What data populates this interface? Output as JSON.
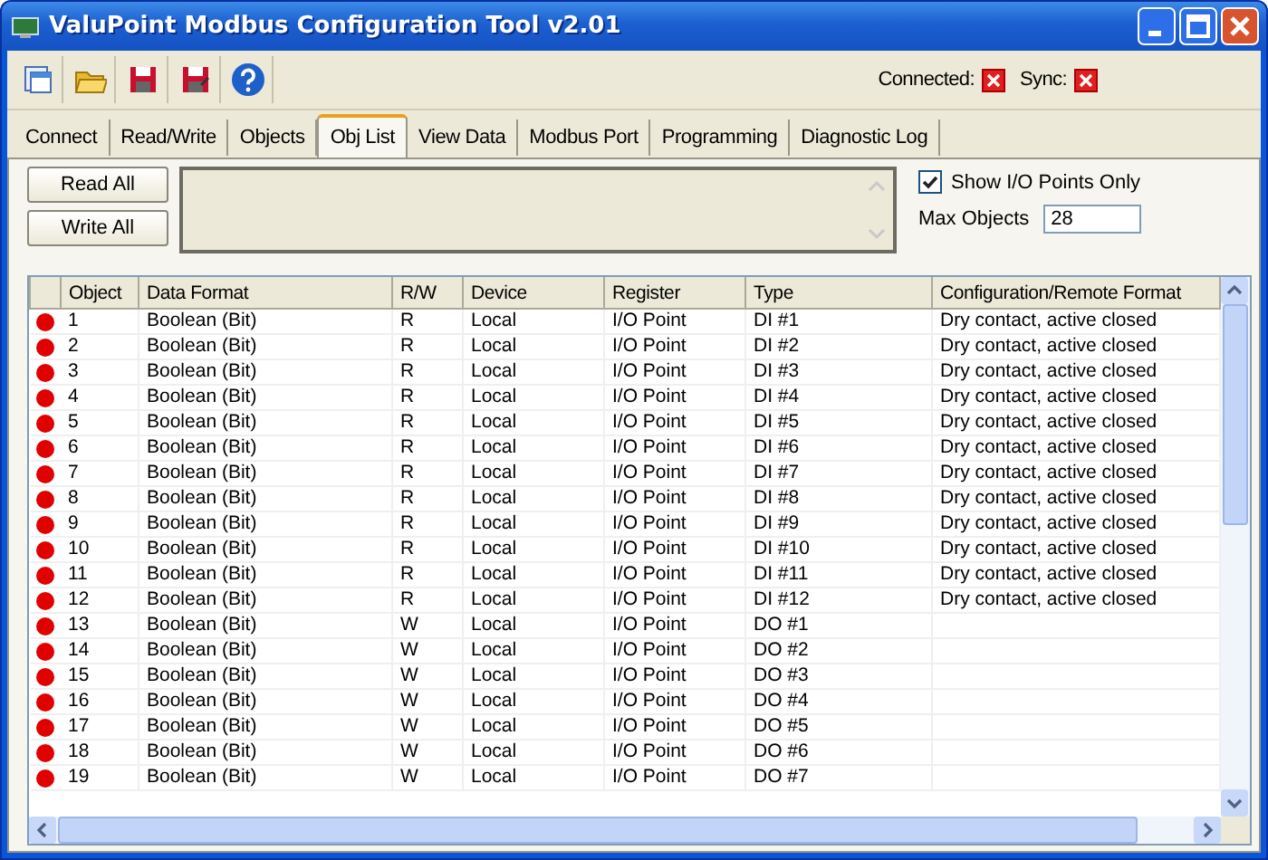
{
  "window": {
    "title": "ValuPoint Modbus Configuration Tool v2.01"
  },
  "status": [
    {
      "label": "Connected:",
      "connected": false
    },
    {
      "label": "Sync:",
      "connected": false
    }
  ],
  "tabs": [
    {
      "label": "Connect",
      "selected": false
    },
    {
      "label": "Read/Write",
      "selected": false
    },
    {
      "label": "Objects",
      "selected": false
    },
    {
      "label": "Obj List",
      "selected": true
    },
    {
      "label": "View Data",
      "selected": false
    },
    {
      "label": "Modbus Port",
      "selected": false
    },
    {
      "label": "Programming",
      "selected": false
    },
    {
      "label": "Diagnostic Log",
      "selected": false
    }
  ],
  "buttons": [
    "Read All",
    "Write All"
  ],
  "show_io_only": {
    "label": "Show I/O Points Only",
    "checked": true
  },
  "max_objects": {
    "label": "Max Objects",
    "value": "28"
  },
  "table": {
    "columns": [
      "Object",
      "Data Format",
      "R/W",
      "Device",
      "Register",
      "Type",
      "Configuration/Remote Format"
    ],
    "rows": [
      {
        "object": "1",
        "data_format": "Boolean (Bit)",
        "rw": "R",
        "device": "Local",
        "register": "I/O Point",
        "type": "DI #1",
        "config": "Dry contact, active closed"
      },
      {
        "object": "2",
        "data_format": "Boolean (Bit)",
        "rw": "R",
        "device": "Local",
        "register": "I/O Point",
        "type": "DI #2",
        "config": "Dry contact, active closed"
      },
      {
        "object": "3",
        "data_format": "Boolean (Bit)",
        "rw": "R",
        "device": "Local",
        "register": "I/O Point",
        "type": "DI #3",
        "config": "Dry contact, active closed"
      },
      {
        "object": "4",
        "data_format": "Boolean (Bit)",
        "rw": "R",
        "device": "Local",
        "register": "I/O Point",
        "type": "DI #4",
        "config": "Dry contact, active closed"
      },
      {
        "object": "5",
        "data_format": "Boolean (Bit)",
        "rw": "R",
        "device": "Local",
        "register": "I/O Point",
        "type": "DI #5",
        "config": "Dry contact, active closed"
      },
      {
        "object": "6",
        "data_format": "Boolean (Bit)",
        "rw": "R",
        "device": "Local",
        "register": "I/O Point",
        "type": "DI #6",
        "config": "Dry contact, active closed"
      },
      {
        "object": "7",
        "data_format": "Boolean (Bit)",
        "rw": "R",
        "device": "Local",
        "register": "I/O Point",
        "type": "DI #7",
        "config": "Dry contact, active closed"
      },
      {
        "object": "8",
        "data_format": "Boolean (Bit)",
        "rw": "R",
        "device": "Local",
        "register": "I/O Point",
        "type": "DI #8",
        "config": "Dry contact, active closed"
      },
      {
        "object": "9",
        "data_format": "Boolean (Bit)",
        "rw": "R",
        "device": "Local",
        "register": "I/O Point",
        "type": "DI #9",
        "config": "Dry contact, active closed"
      },
      {
        "object": "10",
        "data_format": "Boolean (Bit)",
        "rw": "R",
        "device": "Local",
        "register": "I/O Point",
        "type": "DI #10",
        "config": "Dry contact, active closed"
      },
      {
        "object": "11",
        "data_format": "Boolean (Bit)",
        "rw": "R",
        "device": "Local",
        "register": "I/O Point",
        "type": "DI #11",
        "config": "Dry contact, active closed"
      },
      {
        "object": "12",
        "data_format": "Boolean (Bit)",
        "rw": "R",
        "device": "Local",
        "register": "I/O Point",
        "type": "DI #12",
        "config": "Dry contact, active closed"
      },
      {
        "object": "13",
        "data_format": "Boolean (Bit)",
        "rw": "W",
        "device": "Local",
        "register": "I/O Point",
        "type": "DO #1"
      },
      {
        "object": "14",
        "data_format": "Boolean (Bit)",
        "rw": "W",
        "device": "Local",
        "register": "I/O Point",
        "type": "DO #2"
      },
      {
        "object": "15",
        "data_format": "Boolean (Bit)",
        "rw": "W",
        "device": "Local",
        "register": "I/O Point",
        "type": "DO #3"
      },
      {
        "object": "16",
        "data_format": "Boolean (Bit)",
        "rw": "W",
        "device": "Local",
        "register": "I/O Point",
        "type": "DO #4"
      },
      {
        "object": "17",
        "data_format": "Boolean (Bit)",
        "rw": "W",
        "device": "Local",
        "register": "I/O Point",
        "type": "DO #5"
      },
      {
        "object": "18",
        "data_format": "Boolean (Bit)",
        "rw": "W",
        "device": "Local",
        "register": "I/O Point",
        "type": "DO #6"
      },
      {
        "object": "19",
        "data_format": "Boolean (Bit)",
        "rw": "W",
        "device": "Local",
        "register": "I/O Point",
        "type": "DO #7"
      }
    ]
  }
}
